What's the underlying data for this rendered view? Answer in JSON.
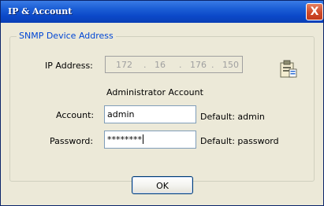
{
  "window": {
    "title": "IP & Account",
    "close_symbol": "X",
    "accent_color": "#0b48c8"
  },
  "group": {
    "title": "SNMP Device Address",
    "ip_label": "IP Address:",
    "ip_octets": [
      "172",
      "16",
      "176",
      "150"
    ],
    "ip_separator": ".",
    "admin_heading": "Administrator Account",
    "account_label": "Account:",
    "account_value": "admin",
    "account_default": "Default: admin",
    "password_label": "Password:",
    "password_value": "********",
    "password_default": "Default: password",
    "icon": "device-info-icon"
  },
  "ok_button": "OK"
}
